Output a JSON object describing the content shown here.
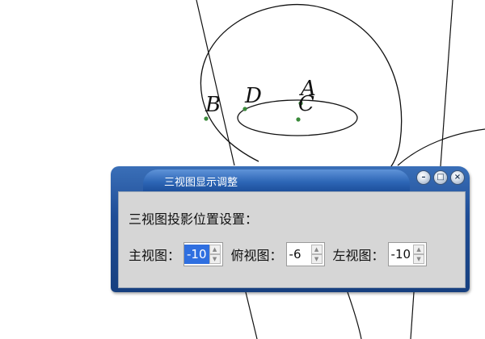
{
  "geometry": {
    "points": [
      {
        "id": "B",
        "label": "B"
      },
      {
        "id": "D",
        "label": "D"
      },
      {
        "id": "A",
        "label": "A"
      },
      {
        "id": "C",
        "label": "C"
      }
    ],
    "point_color": "#3a8a3a"
  },
  "dialog": {
    "title": "三视图显示调整",
    "heading": "三视图投影位置设置：",
    "fields": [
      {
        "label": "主视图：",
        "value": "-10",
        "selected": true
      },
      {
        "label": "俯视图：",
        "value": "-6",
        "selected": false
      },
      {
        "label": "左视图：",
        "value": "-10",
        "selected": false
      }
    ],
    "controls": [
      "minimize-icon",
      "maximize-icon",
      "close-icon"
    ],
    "colors": {
      "frame": "#1f4d96",
      "panel": "#d6d6d6",
      "selection": "#2f6fe0"
    }
  }
}
